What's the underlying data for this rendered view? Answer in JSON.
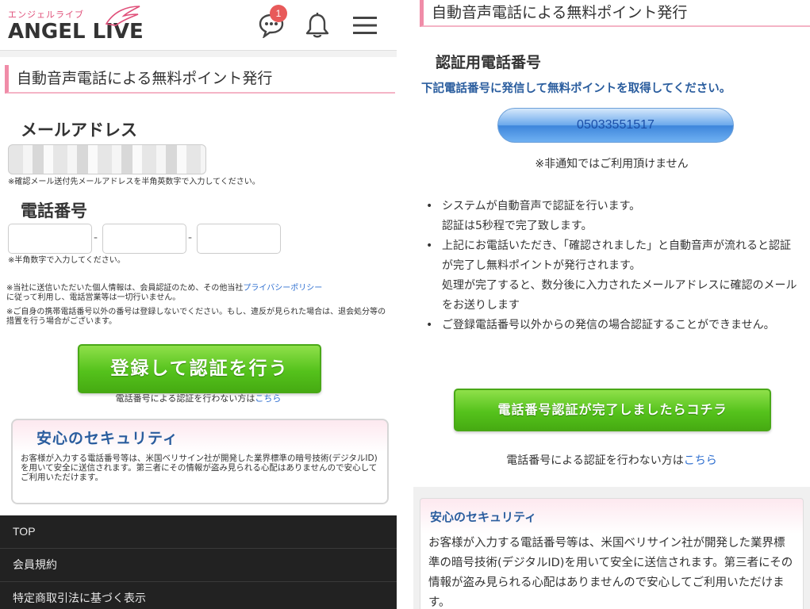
{
  "left": {
    "logo": {
      "kana": "エンジェルライブ",
      "main": "ANGEL LIVE"
    },
    "header": {
      "notification_count": "1"
    },
    "section_title": "自動音声電話による無料ポイント発行",
    "email": {
      "label": "メールアドレス",
      "note": "※確認メール送付先メールアドレスを半角英数字で入力してください。"
    },
    "tel": {
      "label": "電話番号",
      "dash": "-",
      "note": "※半角数字で入力してください。"
    },
    "privacy": {
      "before": "※当社に送信いただいた個人情報は、会員認証のため、その他当社",
      "link": "プライバシーポリシー",
      "after": "に従って利用し、電話営業等は一切行いません。"
    },
    "warning": "※ご自身の携帯電話番号以外の番号は登録しないでください。もし、違反が見られた場合は、退会処分等の措置を行う場合がございます。",
    "register_button": "登録して認証を行う",
    "noauth": {
      "text": "電話番号による認証を行わない方は",
      "link": "こちら"
    },
    "security": {
      "title": "安心のセキュリティ",
      "body": "お客様が入力する電話番号等は、米国ベリサイン社が開発した業界標準の暗号技術(デジタルID)を用いて安全に送信されます。第三者にその情報が盗み見られる心配はありませんので安心してご利用いただけます。"
    },
    "footer": [
      "TOP",
      "会員規約",
      "特定商取引法に基づく表示"
    ]
  },
  "right": {
    "section_title": "自動音声電話による無料ポイント発行",
    "auth_title": "認証用電話番号",
    "auth_desc": "下記電話番号に発信して無料ポイントを取得してください。",
    "phone_number": "05033551517",
    "nonotify": "※非通知ではご利用頂けません",
    "bullets": [
      "システムが自動音声で認証を行います。\n認証は5秒程で完了致します。",
      "上記にお電話いただき、「確認されました」と自動音声が流れると認証が完了し無料ポイントが発行されます。\n処理が完了すると、数分後に入力されたメールアドレスに確認のメールをお送りします",
      "ご登録電話番号以外からの発信の場合認証することができません。"
    ],
    "complete_button": "電話番号認証が完了しましたらコチラ",
    "noauth": {
      "text": "電話番号による認証を行わない方は",
      "link": "こちら"
    },
    "security": {
      "title": "安心のセキュリティ",
      "body": "お客様が入力する電話番号等は、米国ベリサイン社が開発した業界標準の暗号技術(デジタルID)を用いて安全に送信されます。第三者にその情報が盗み見られる心配はありませんので安心してご利用いただけます。"
    }
  },
  "colors": {
    "accent_pink": "#f08ca8",
    "link_blue": "#2f6fd0",
    "title_blue": "#2a5d9e",
    "button_green": "#55c21c",
    "badge_red": "#e85a5a"
  },
  "icons": [
    "chat-bubble-icon",
    "bell-icon",
    "hamburger-menu-icon",
    "wing-icon"
  ]
}
